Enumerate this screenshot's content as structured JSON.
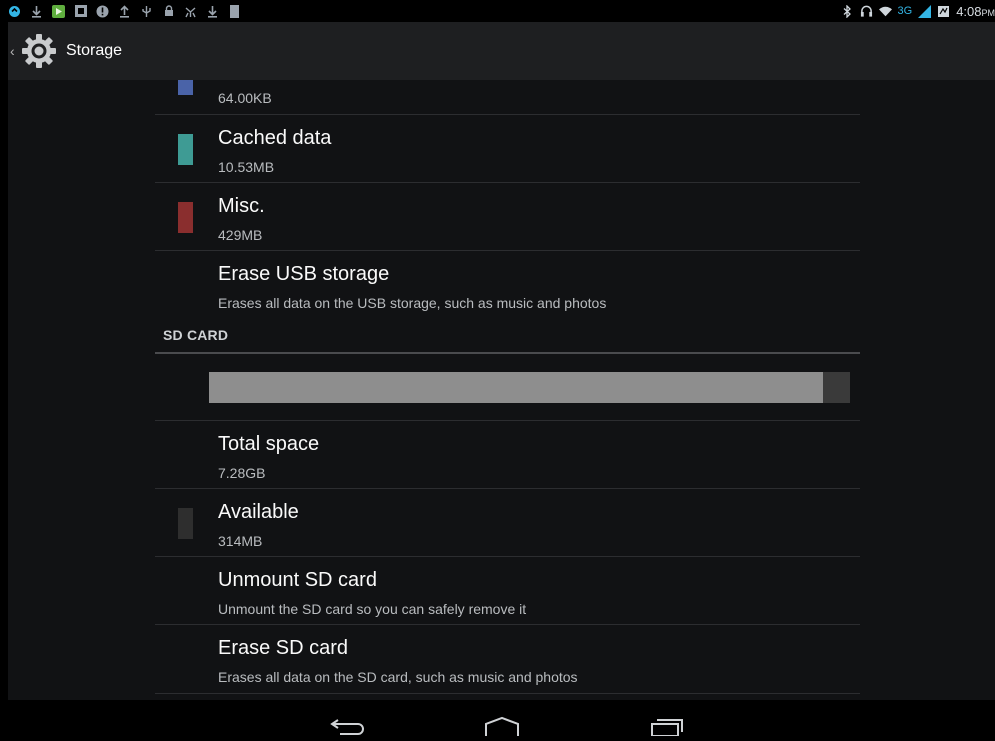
{
  "status_bar": {
    "time": "4:08",
    "time_suffix": "PM",
    "network": "3G",
    "left_icons": [
      "sync-icon",
      "download-icon",
      "play-store-icon",
      "notification-icon",
      "alert-icon",
      "upload-icon",
      "usb-icon",
      "lock-icon",
      "debug-icon",
      "download-icon",
      "sdcard-icon"
    ],
    "right_icons": [
      "bluetooth-icon",
      "headset-icon",
      "wifi-icon",
      "signal-icon",
      "battery-icon"
    ]
  },
  "action_bar": {
    "title": "Storage",
    "icon": "settings-gear-icon"
  },
  "internal_items": [
    {
      "title": "",
      "sub": "64.00KB",
      "color": "#4a63a8"
    },
    {
      "title": "Cached data",
      "sub": "10.53MB",
      "color": "#3e9b94"
    },
    {
      "title": "Misc.",
      "sub": "429MB",
      "color": "#8a2e2e"
    },
    {
      "title": "Erase USB storage",
      "sub": "Erases all data on the USB storage, such as music and photos",
      "color": ""
    }
  ],
  "sd_card": {
    "header": "SD CARD",
    "usage_fraction": 0.958,
    "used_color": "#8e8e8e",
    "free_color": "#3a3a3a",
    "items": [
      {
        "title": "Total space",
        "sub": "7.28GB",
        "color": ""
      },
      {
        "title": "Available",
        "sub": "314MB",
        "color": "#2e2e2e"
      },
      {
        "title": "Unmount SD card",
        "sub": "Unmount the SD card so you can safely remove it",
        "color": ""
      },
      {
        "title": "Erase SD card",
        "sub": "Erases all data on the SD card, such as music and photos",
        "color": ""
      }
    ]
  },
  "nav_bar": {
    "buttons": [
      "back-icon",
      "home-icon",
      "recents-icon"
    ]
  }
}
